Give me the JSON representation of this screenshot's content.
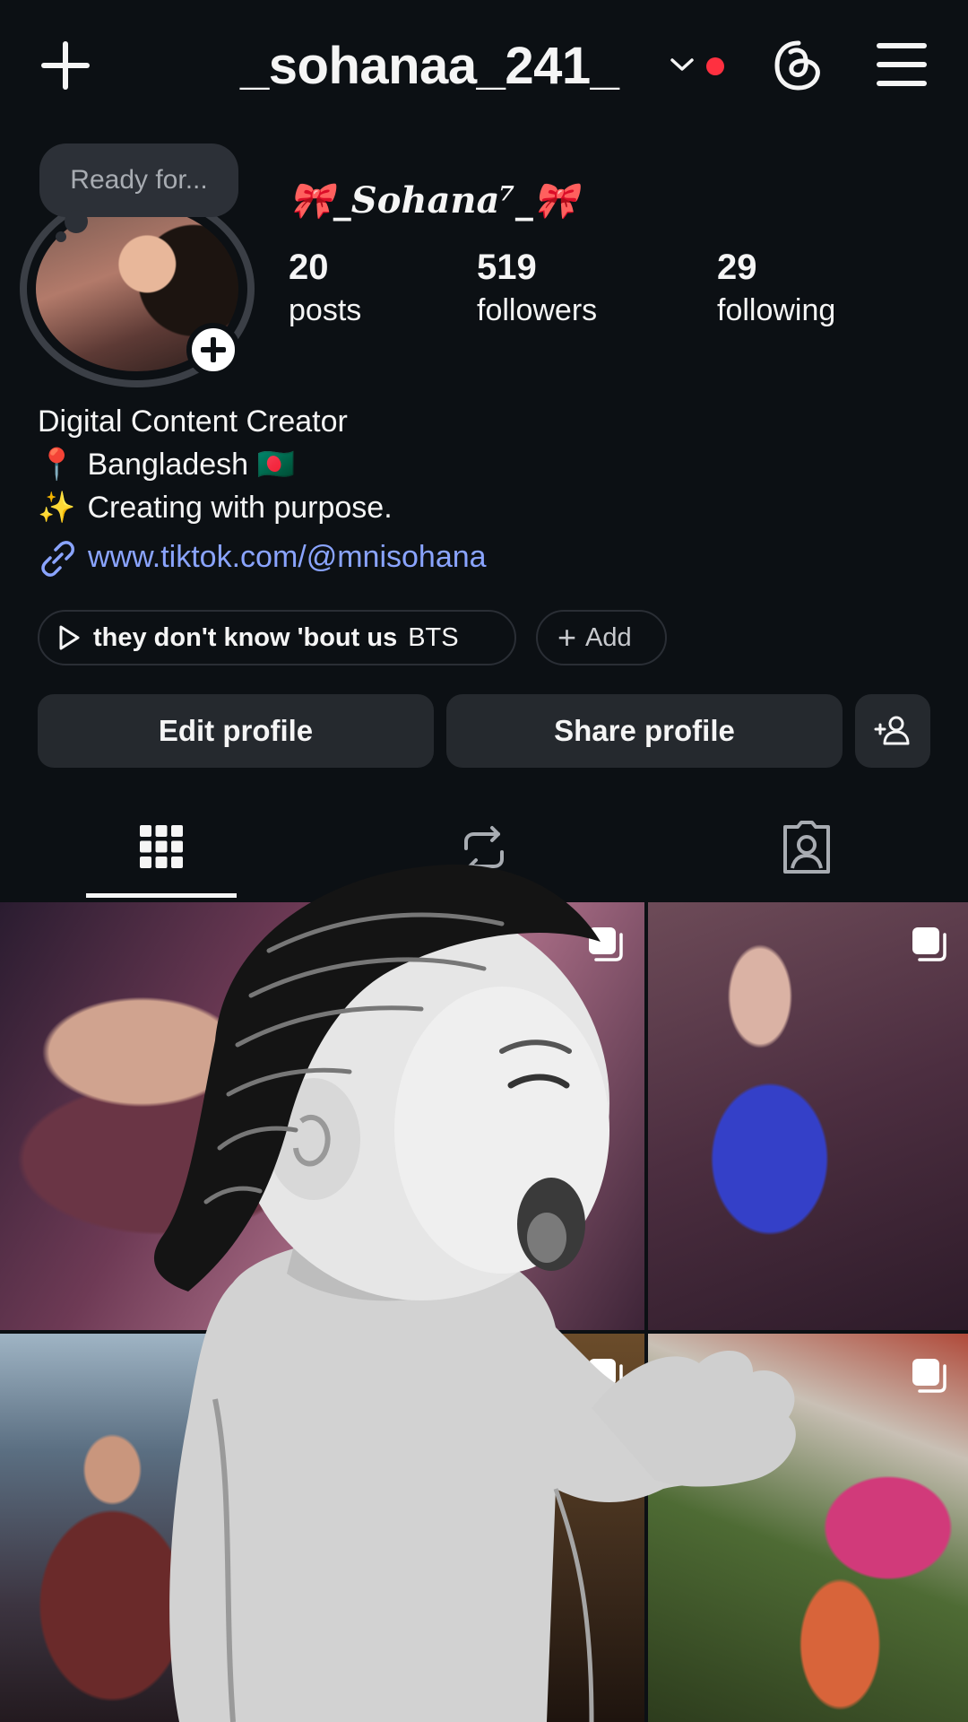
{
  "header": {
    "username": "_sohanaa_241_",
    "icons": {
      "new": "plus-icon",
      "switch": "chevron-down-icon",
      "threads": "threads-icon",
      "menu": "hamburger-menu-icon"
    },
    "notification_dot_color": "#ff3040"
  },
  "profile": {
    "note": "Ready for...",
    "display_name": "🎀_Sohana⁷_🎀",
    "stats": [
      {
        "value": "20",
        "label": "posts"
      },
      {
        "value": "519",
        "label": "followers"
      },
      {
        "value": "29",
        "label": "following"
      }
    ]
  },
  "bio": {
    "lines": [
      {
        "emoji": "",
        "text": "Digital Content Creator"
      },
      {
        "emoji": "📍",
        "text": "Bangladesh 🇧🇩"
      },
      {
        "emoji": "✨",
        "text": "Creating with purpose."
      }
    ],
    "link": "www.tiktok.com/@mnisohana",
    "link_color": "#8aa4ff"
  },
  "chips": {
    "music_song": "they don't know 'bout us",
    "music_artist": "BTS",
    "add_label": "Add"
  },
  "buttons": {
    "edit": "Edit profile",
    "share": "Share profile",
    "discover_people_icon": "add-person-icon"
  },
  "tabs": [
    {
      "name": "posts-grid",
      "icon": "grid-icon",
      "active": true
    },
    {
      "name": "reposts",
      "icon": "repost-icon",
      "active": false
    },
    {
      "name": "tagged",
      "icon": "tagged-person-icon",
      "active": false
    }
  ],
  "posts": [
    {
      "type": "carousel"
    },
    {
      "type": "carousel"
    },
    {
      "type": "image"
    },
    {
      "type": "carousel"
    },
    {
      "type": "carousel"
    }
  ]
}
